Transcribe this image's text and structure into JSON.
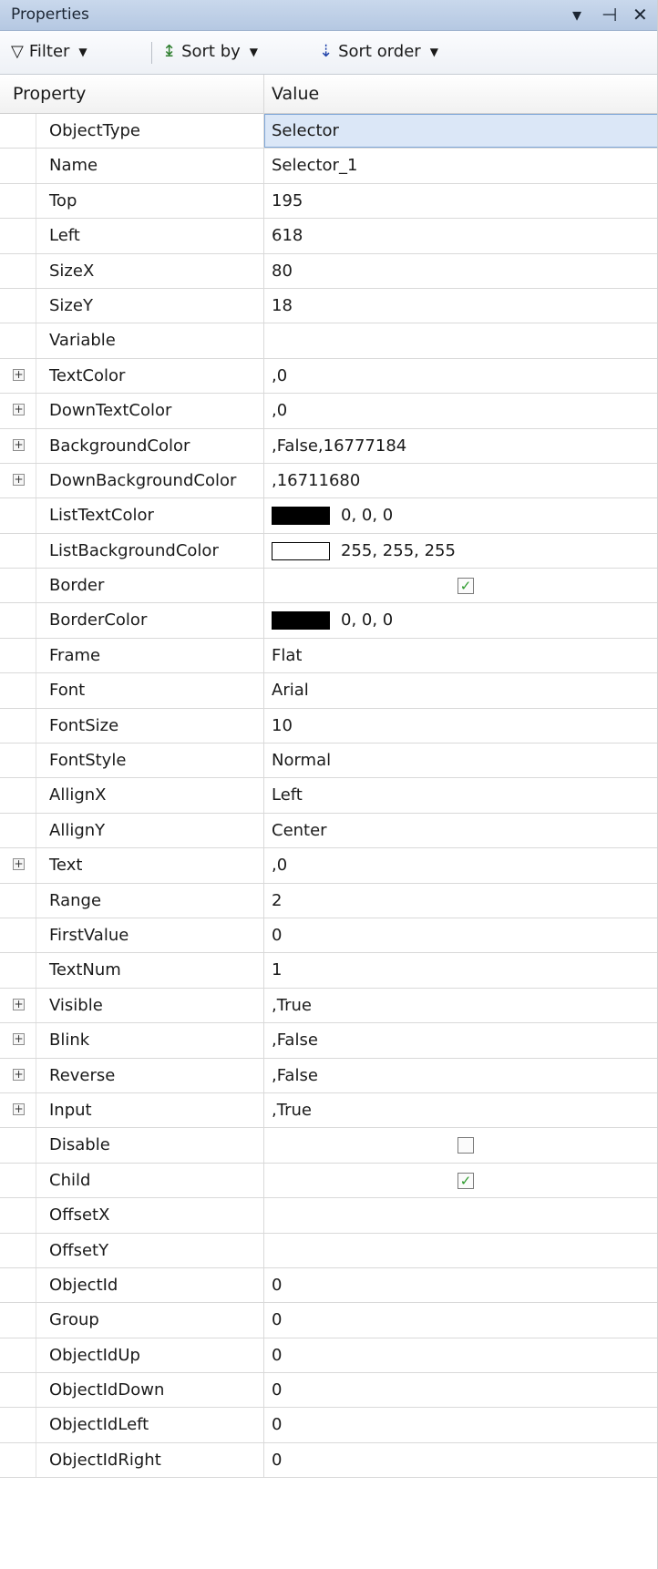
{
  "panel": {
    "title": "Properties"
  },
  "title_buttons": {
    "dropdown": "▾",
    "pin": "⊣",
    "close": "✕"
  },
  "toolbar": {
    "filter_label": "Filter",
    "sort_by_label": "Sort by",
    "sort_order_label": "Sort order"
  },
  "grid": {
    "columns": [
      "Property",
      "Value"
    ],
    "rows": [
      {
        "name": "ObjectType",
        "value": "Selector",
        "expandable": false,
        "selected": true
      },
      {
        "name": "Name",
        "value": "Selector_1",
        "expandable": false
      },
      {
        "name": "Top",
        "value": "195",
        "expandable": false
      },
      {
        "name": "Left",
        "value": "618",
        "expandable": false
      },
      {
        "name": "SizeX",
        "value": "80",
        "expandable": false
      },
      {
        "name": "SizeY",
        "value": "18",
        "expandable": false
      },
      {
        "name": "Variable",
        "value": "",
        "expandable": false
      },
      {
        "name": "TextColor",
        "value": ",0",
        "expandable": true
      },
      {
        "name": "DownTextColor",
        "value": ",0",
        "expandable": true
      },
      {
        "name": "BackgroundColor",
        "value": ",False,16777184",
        "expandable": true
      },
      {
        "name": "DownBackgroundColor",
        "value": ",16711680",
        "expandable": true
      },
      {
        "name": "ListTextColor",
        "value": "0, 0, 0",
        "swatch": "#000000",
        "expandable": false
      },
      {
        "name": "ListBackgroundColor",
        "value": "255, 255, 255",
        "swatch": "#ffffff",
        "expandable": false
      },
      {
        "name": "Border",
        "checkbox": true,
        "checked": true,
        "expandable": false
      },
      {
        "name": "BorderColor",
        "value": "0, 0, 0",
        "swatch": "#000000",
        "expandable": false
      },
      {
        "name": "Frame",
        "value": "Flat",
        "expandable": false
      },
      {
        "name": "Font",
        "value": "Arial",
        "expandable": false
      },
      {
        "name": "FontSize",
        "value": "10",
        "expandable": false
      },
      {
        "name": "FontStyle",
        "value": "Normal",
        "expandable": false
      },
      {
        "name": "AllignX",
        "value": "Left",
        "expandable": false
      },
      {
        "name": "AllignY",
        "value": "Center",
        "expandable": false
      },
      {
        "name": "Text",
        "value": ",0",
        "expandable": true
      },
      {
        "name": "Range",
        "value": "2",
        "expandable": false
      },
      {
        "name": "FirstValue",
        "value": "0",
        "expandable": false
      },
      {
        "name": "TextNum",
        "value": "1",
        "expandable": false
      },
      {
        "name": "Visible",
        "value": ",True",
        "expandable": true
      },
      {
        "name": "Blink",
        "value": ",False",
        "expandable": true
      },
      {
        "name": "Reverse",
        "value": ",False",
        "expandable": true
      },
      {
        "name": "Input",
        "value": ",True",
        "expandable": true
      },
      {
        "name": "Disable",
        "checkbox": true,
        "checked": false,
        "expandable": false
      },
      {
        "name": "Child",
        "checkbox": true,
        "checked": true,
        "expandable": false
      },
      {
        "name": "OffsetX",
        "value": "",
        "expandable": false
      },
      {
        "name": "OffsetY",
        "value": "",
        "expandable": false
      },
      {
        "name": "ObjectId",
        "value": "0",
        "expandable": false
      },
      {
        "name": "Group",
        "value": "0",
        "expandable": false
      },
      {
        "name": "ObjectIdUp",
        "value": "0",
        "expandable": false
      },
      {
        "name": "ObjectIdDown",
        "value": "0",
        "expandable": false
      },
      {
        "name": "ObjectIdLeft",
        "value": "0",
        "expandable": false
      },
      {
        "name": "ObjectIdRight",
        "value": "0",
        "expandable": false
      }
    ]
  }
}
